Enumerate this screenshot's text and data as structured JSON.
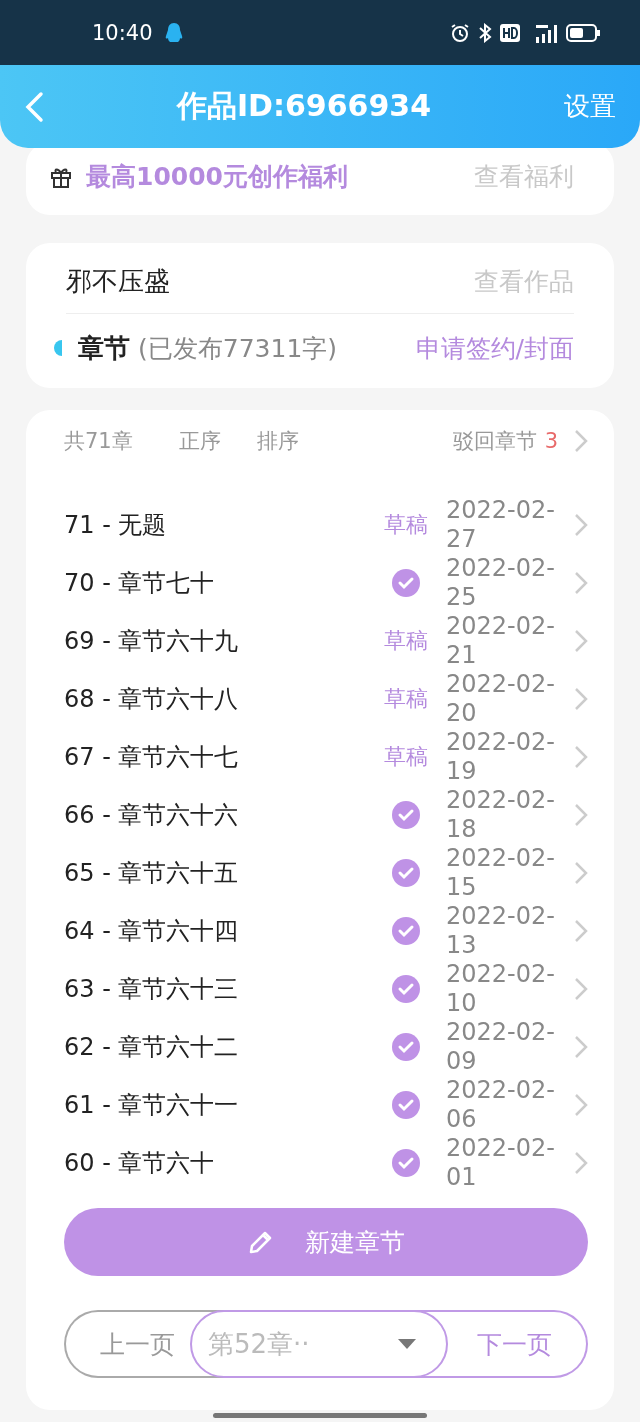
{
  "status_bar": {
    "time": "10:40"
  },
  "header": {
    "title": "作品ID:6966934",
    "action": "设置"
  },
  "promo": {
    "text": "最高10000元创作福利",
    "link": "查看福利"
  },
  "work": {
    "title": "邪不压盛",
    "link": "查看作品",
    "section": "章节",
    "published": "(已发布77311字)",
    "action": "申请签约/封面"
  },
  "chapters": {
    "count": "共71章",
    "order": "正序",
    "sort": "排序",
    "rejected_label": "驳回章节",
    "rejected_count": "3",
    "items": [
      {
        "title": "71 - 无题",
        "kind": "draft",
        "badge": "草稿",
        "date": "2022-02-27"
      },
      {
        "title": "70 - 章节七十",
        "kind": "published",
        "date": "2022-02-25"
      },
      {
        "title": "69 - 章节六十九",
        "kind": "draft",
        "badge": "草稿",
        "date": "2022-02-21"
      },
      {
        "title": "68 - 章节六十八",
        "kind": "draft",
        "badge": "草稿",
        "date": "2022-02-20"
      },
      {
        "title": "67 - 章节六十七",
        "kind": "draft",
        "badge": "草稿",
        "date": "2022-02-19"
      },
      {
        "title": "66 - 章节六十六",
        "kind": "published",
        "date": "2022-02-18"
      },
      {
        "title": "65 - 章节六十五",
        "kind": "published",
        "date": "2022-02-15"
      },
      {
        "title": "64 - 章节六十四",
        "kind": "published",
        "date": "2022-02-13"
      },
      {
        "title": "63 - 章节六十三",
        "kind": "published",
        "date": "2022-02-10"
      },
      {
        "title": "62 - 章节六十二",
        "kind": "published",
        "date": "2022-02-09"
      },
      {
        "title": "61 - 章节六十一",
        "kind": "published",
        "date": "2022-02-06"
      },
      {
        "title": "60 - 章节六十",
        "kind": "published",
        "date": "2022-02-01"
      }
    ]
  },
  "new_button": "新建章节",
  "pager": {
    "prev": "上一页",
    "current": "第52章··",
    "next": "下一页"
  }
}
